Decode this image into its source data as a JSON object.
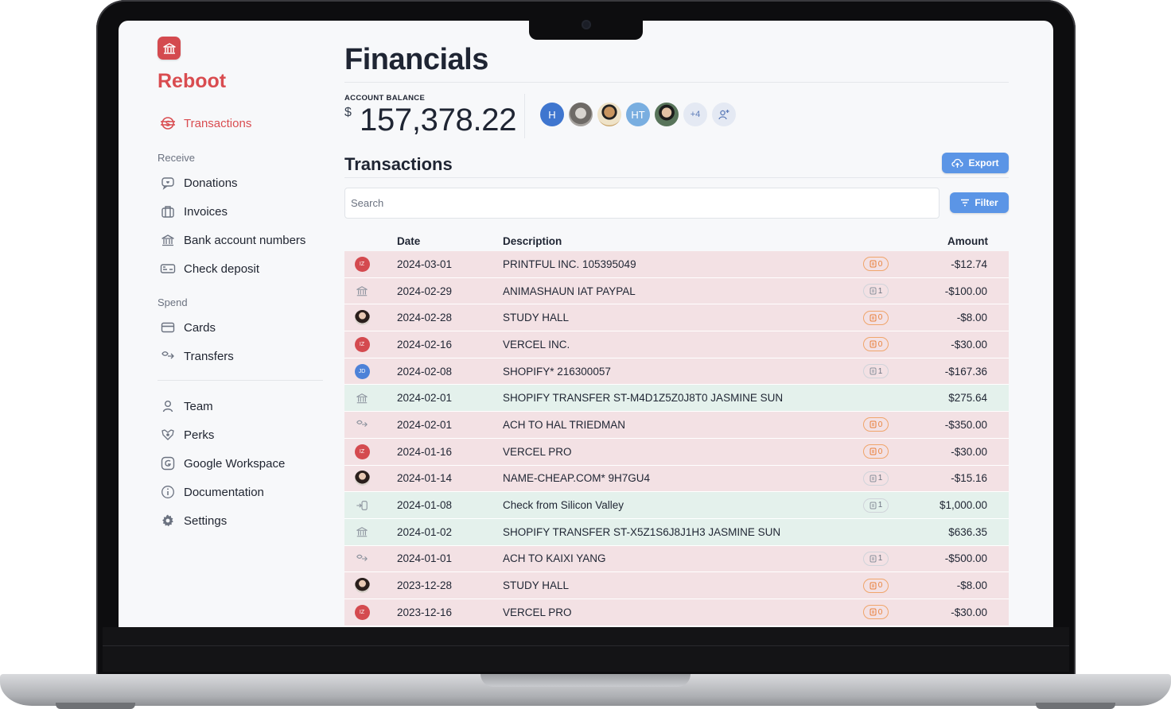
{
  "app": {
    "brand": "Reboot"
  },
  "sidebar": {
    "primary": {
      "label": "Transactions",
      "icon": "transactions-icon"
    },
    "receive_label": "Receive",
    "receive_items": [
      {
        "label": "Donations",
        "icon": "donations-icon"
      },
      {
        "label": "Invoices",
        "icon": "invoices-icon"
      },
      {
        "label": "Bank account numbers",
        "icon": "bank-icon"
      },
      {
        "label": "Check deposit",
        "icon": "check-deposit-icon"
      }
    ],
    "spend_label": "Spend",
    "spend_items": [
      {
        "label": "Cards",
        "icon": "card-icon"
      },
      {
        "label": "Transfers",
        "icon": "transfer-icon"
      }
    ],
    "other_items": [
      {
        "label": "Team",
        "icon": "team-icon"
      },
      {
        "label": "Perks",
        "icon": "perks-icon"
      },
      {
        "label": "Google Workspace",
        "icon": "google-icon"
      },
      {
        "label": "Documentation",
        "icon": "info-icon"
      },
      {
        "label": "Settings",
        "icon": "gear-icon"
      }
    ]
  },
  "main": {
    "title": "Financials",
    "balance_label": "ACCOUNT BALANCE",
    "currency_symbol": "$",
    "balance": "157,378.22",
    "members": [
      {
        "initials": "H",
        "color": "#3f76cf"
      },
      {
        "initials": "",
        "color": "#8a8f96"
      },
      {
        "initials": "",
        "color": "#c9a46a"
      },
      {
        "initials": "HT",
        "color": "#79aee0"
      },
      {
        "initials": "",
        "color": "#3c5a3a"
      }
    ],
    "more_members": "+4",
    "transactions_title": "Transactions",
    "export_label": "Export",
    "filter_label": "Filter",
    "search_placeholder": "Search",
    "columns": {
      "date": "Date",
      "description": "Description",
      "amount": "Amount"
    }
  },
  "transactions": [
    {
      "type": "out",
      "icon": "iz",
      "date": "2024-03-01",
      "description": "PRINTFUL INC. 105395049",
      "receipts": "0",
      "receipt_missing": true,
      "amount": "-$12.74"
    },
    {
      "type": "out",
      "icon": "bank",
      "date": "2024-02-29",
      "description": "ANIMASHAUN IAT PAYPAL",
      "receipts": "1",
      "receipt_missing": false,
      "amount": "-$100.00"
    },
    {
      "type": "out",
      "icon": "photo",
      "date": "2024-02-28",
      "description": "STUDY HALL",
      "receipts": "0",
      "receipt_missing": true,
      "amount": "-$8.00"
    },
    {
      "type": "out",
      "icon": "iz",
      "date": "2024-02-16",
      "description": "VERCEL INC.",
      "receipts": "0",
      "receipt_missing": true,
      "amount": "-$30.00"
    },
    {
      "type": "out",
      "icon": "jd",
      "date": "2024-02-08",
      "description": "SHOPIFY* 216300057",
      "receipts": "1",
      "receipt_missing": false,
      "amount": "-$167.36"
    },
    {
      "type": "in",
      "icon": "bank",
      "date": "2024-02-01",
      "description": "SHOPIFY TRANSFER ST-M4D1Z5Z0J8T0 JASMINE SUN",
      "receipts": "",
      "receipt_missing": false,
      "amount": "$275.64"
    },
    {
      "type": "out",
      "icon": "transfer",
      "date": "2024-02-01",
      "description": "ACH TO HAL TRIEDMAN",
      "receipts": "0",
      "receipt_missing": true,
      "amount": "-$350.00"
    },
    {
      "type": "out",
      "icon": "iz",
      "date": "2024-01-16",
      "description": "VERCEL PRO",
      "receipts": "0",
      "receipt_missing": true,
      "amount": "-$30.00"
    },
    {
      "type": "out",
      "icon": "photo",
      "date": "2024-01-14",
      "description": "NAME-CHEAP.COM* 9H7GU4",
      "receipts": "1",
      "receipt_missing": false,
      "amount": "-$15.16"
    },
    {
      "type": "in",
      "icon": "check",
      "date": "2024-01-08",
      "description": "Check from Silicon Valley",
      "receipts": "1",
      "receipt_missing": false,
      "amount": "$1,000.00"
    },
    {
      "type": "in",
      "icon": "bank",
      "date": "2024-01-02",
      "description": "SHOPIFY TRANSFER ST-X5Z1S6J8J1H3 JASMINE SUN",
      "receipts": "",
      "receipt_missing": false,
      "amount": "$636.35"
    },
    {
      "type": "out",
      "icon": "transfer",
      "date": "2024-01-01",
      "description": "ACH TO KAIXI YANG",
      "receipts": "1",
      "receipt_missing": false,
      "amount": "-$500.00"
    },
    {
      "type": "out",
      "icon": "photo",
      "date": "2023-12-28",
      "description": "STUDY HALL",
      "receipts": "0",
      "receipt_missing": true,
      "amount": "-$8.00"
    },
    {
      "type": "out",
      "icon": "iz",
      "date": "2023-12-16",
      "description": "VERCEL PRO",
      "receipts": "0",
      "receipt_missing": true,
      "amount": "-$30.00"
    }
  ],
  "avatar_initials": {
    "iz": "IZ",
    "jd": "JD"
  }
}
